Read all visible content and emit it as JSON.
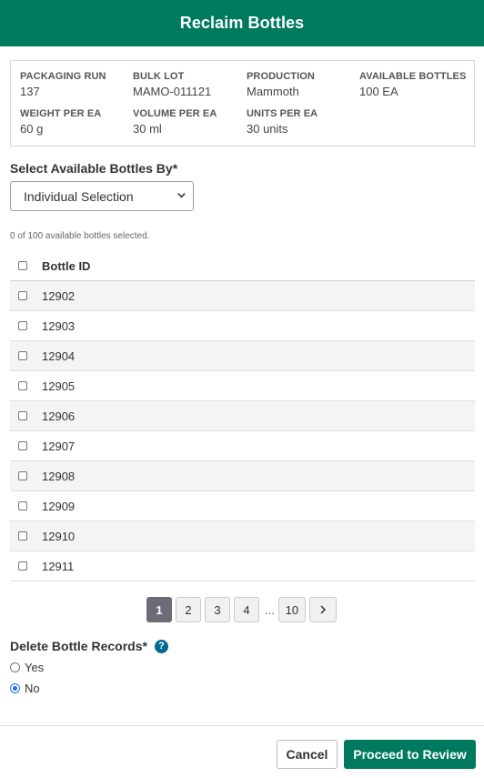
{
  "title": "Reclaim Bottles",
  "info": [
    {
      "label": "Packaging Run",
      "value": "137"
    },
    {
      "label": "Bulk Lot",
      "value": "MAMO-011121"
    },
    {
      "label": "Production",
      "value": "Mammoth"
    },
    {
      "label": "Available Bottles",
      "value": "100 EA"
    },
    {
      "label": "Weight Per EA",
      "value": "60 g"
    },
    {
      "label": "Volume Per EA",
      "value": "30 ml"
    },
    {
      "label": "Units Per EA",
      "value": "30 units"
    }
  ],
  "select": {
    "label": "Select Available Bottles By*",
    "value": "Individual Selection"
  },
  "selection_count": "0 of 100 available bottles selected.",
  "table": {
    "header": "Bottle ID",
    "rows": [
      "12902",
      "12903",
      "12904",
      "12905",
      "12906",
      "12907",
      "12908",
      "12909",
      "12910",
      "12911"
    ]
  },
  "pagination": {
    "pages": [
      "1",
      "2",
      "3",
      "4"
    ],
    "ellipsis": "...",
    "last": "10",
    "next": "›",
    "current": "1"
  },
  "delete_records": {
    "label": "Delete Bottle Records*",
    "help": "?",
    "options": [
      {
        "label": "Yes",
        "checked": false
      },
      {
        "label": "No",
        "checked": true
      }
    ]
  },
  "buttons": {
    "cancel": "Cancel",
    "proceed": "Proceed to Review"
  },
  "colors": {
    "brand": "#007a5e",
    "active_page": "#6c6c76",
    "help_icon": "#006b8f"
  },
  "icons": {
    "select_chevron": "chevron-down-icon",
    "help": "help-icon",
    "next_page": "chevron-right-icon"
  }
}
